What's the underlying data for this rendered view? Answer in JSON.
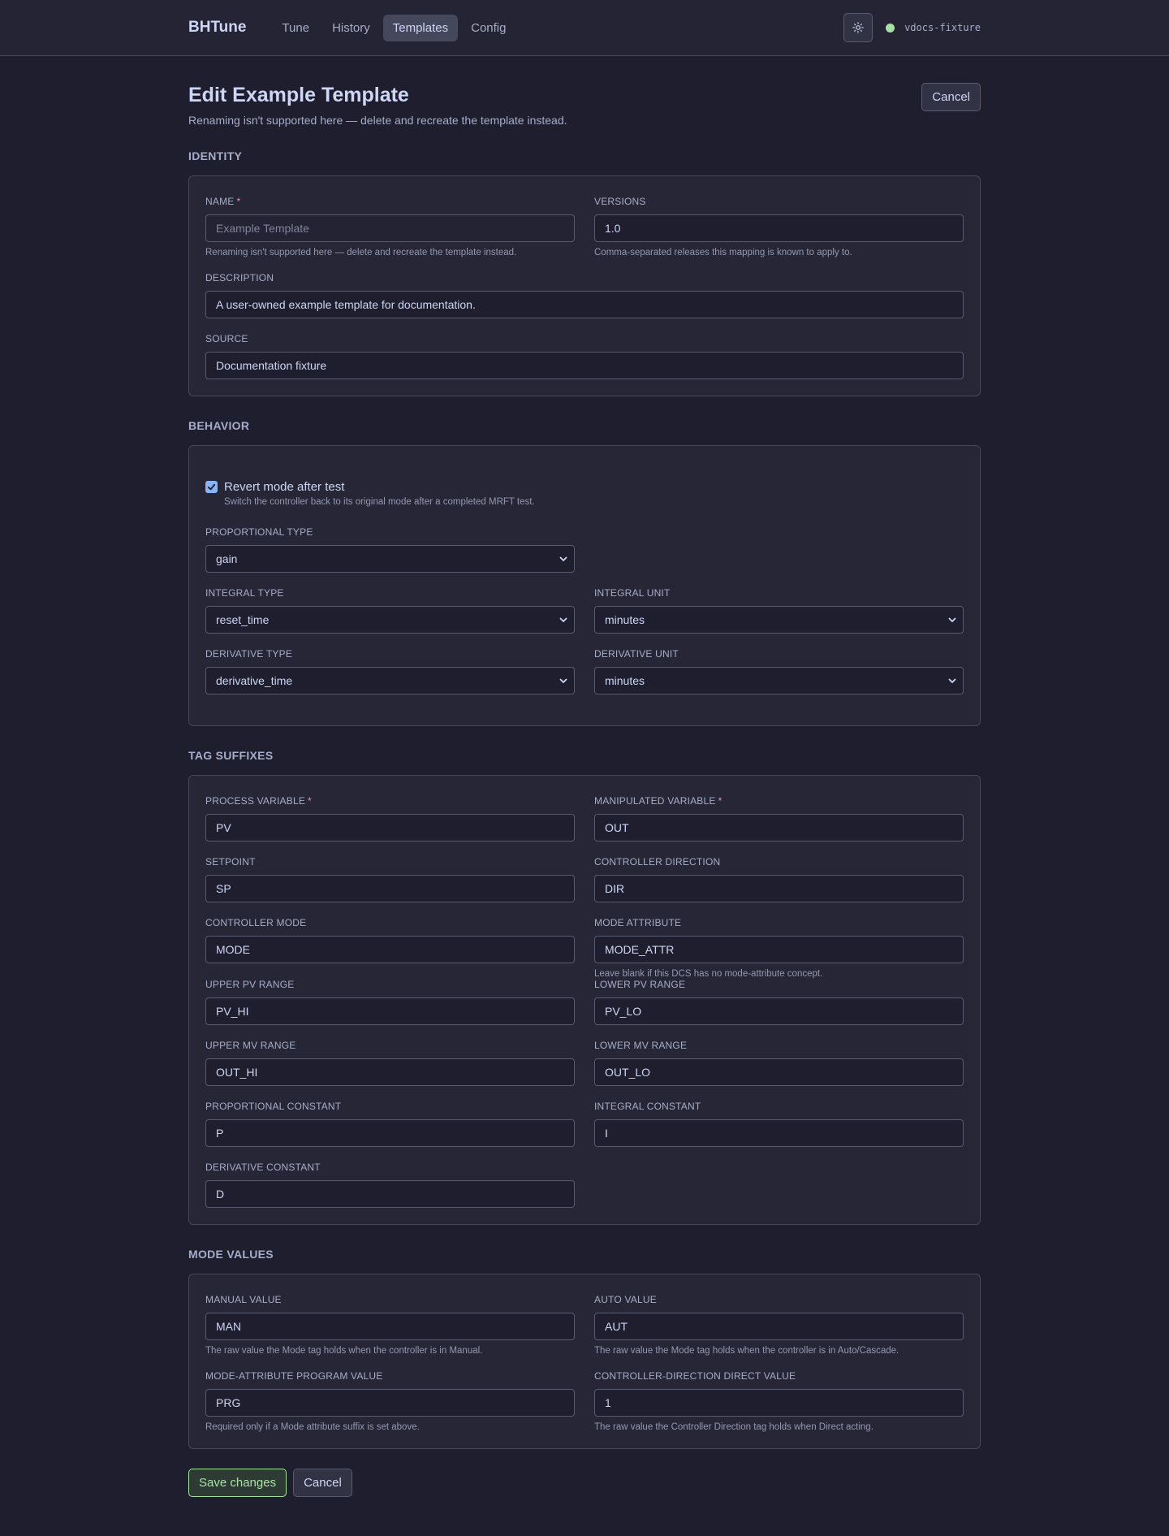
{
  "app": {
    "brand": "BHTune",
    "nav": [
      {
        "label": "Tune"
      },
      {
        "label": "History"
      },
      {
        "label": "Templates"
      },
      {
        "label": "Config"
      }
    ],
    "environment": "vdocs-fixture",
    "status_color": "#a6e3a1"
  },
  "page": {
    "title": "Edit Example Template",
    "subtitle": "Renaming isn't supported here — delete and recreate the template instead.",
    "cancel_label": "Cancel"
  },
  "identity": {
    "title": "IDENTITY",
    "name_label": "NAME",
    "name_placeholder": "Example Template",
    "name_help": "Renaming isn't supported here — delete and recreate the template instead.",
    "versions_label": "VERSIONS",
    "versions_value": "1.0",
    "versions_help": "Comma-separated releases this mapping is known to apply to.",
    "description_label": "DESCRIPTION",
    "description_value": "A user-owned example template for documentation.",
    "source_label": "SOURCE",
    "source_value": "Documentation fixture"
  },
  "behavior": {
    "title": "BEHAVIOR",
    "revert_label": "Revert mode after test",
    "revert_help": "Switch the controller back to its original mode after a completed MRFT test.",
    "proportional_type_label": "PROPORTIONAL TYPE",
    "proportional_type_value": "gain",
    "integral_type_label": "INTEGRAL TYPE",
    "integral_type_value": "reset_time",
    "integral_unit_label": "INTEGRAL UNIT",
    "integral_unit_value": "minutes",
    "derivative_type_label": "DERIVATIVE TYPE",
    "derivative_type_value": "derivative_time",
    "derivative_unit_label": "DERIVATIVE UNIT",
    "derivative_unit_value": "minutes"
  },
  "tags": {
    "title": "TAG SUFFIXES",
    "pv_label": "PROCESS VARIABLE",
    "pv_value": "PV",
    "mv_label": "MANIPULATED VARIABLE",
    "mv_value": "OUT",
    "sp_label": "SETPOINT",
    "sp_value": "SP",
    "dir_label": "CONTROLLER DIRECTION",
    "dir_value": "DIR",
    "mode_label": "CONTROLLER MODE",
    "mode_value": "MODE",
    "mode_attr_label": "MODE ATTRIBUTE",
    "mode_attr_value": "MODE_ATTR",
    "mode_attr_help": "Leave blank if this DCS has no mode-attribute concept.",
    "pv_hi_label": "UPPER PV RANGE",
    "pv_hi_value": "PV_HI",
    "pv_lo_label": "LOWER PV RANGE",
    "pv_lo_value": "PV_LO",
    "mv_hi_label": "UPPER MV RANGE",
    "mv_hi_value": "OUT_HI",
    "mv_lo_label": "LOWER MV RANGE",
    "mv_lo_value": "OUT_LO",
    "p_label": "PROPORTIONAL CONSTANT",
    "p_value": "P",
    "i_label": "INTEGRAL CONSTANT",
    "i_value": "I",
    "d_label": "DERIVATIVE CONSTANT",
    "d_value": "D"
  },
  "modes": {
    "title": "MODE VALUES",
    "manual_label": "MANUAL VALUE",
    "manual_value": "MAN",
    "manual_help": "The raw value the Mode tag holds when the controller is in Manual.",
    "auto_label": "AUTO VALUE",
    "auto_value": "AUT",
    "auto_help": "The raw value the Mode tag holds when the controller is in Auto/Cascade.",
    "program_label": "MODE-ATTRIBUTE PROGRAM VALUE",
    "program_value": "PRG",
    "program_help": "Required only if a Mode attribute suffix is set above.",
    "direct_label": "CONTROLLER-DIRECTION DIRECT VALUE",
    "direct_value": "1",
    "direct_help": "The raw value the Controller Direction tag holds when Direct acting."
  },
  "footer": {
    "save_label": "Save changes",
    "cancel_label": "Cancel"
  }
}
